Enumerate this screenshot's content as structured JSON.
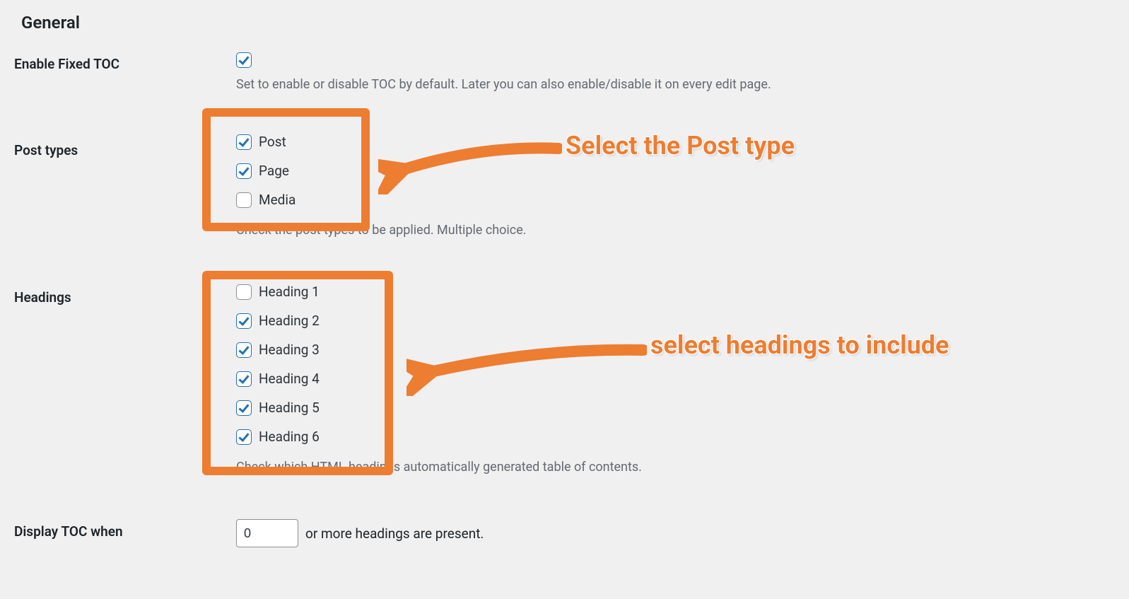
{
  "section_title": "General",
  "rows": {
    "enable_toc": {
      "label": "Enable Fixed TOC",
      "checked": true,
      "description": "Set to enable or disable TOC by default. Later you can also enable/disable it on every edit page."
    },
    "post_types": {
      "label": "Post types",
      "options": [
        {
          "label": "Post",
          "checked": true
        },
        {
          "label": "Page",
          "checked": true
        },
        {
          "label": "Media",
          "checked": false
        }
      ],
      "description": "Check the post types to be applied. Multiple choice."
    },
    "headings": {
      "label": "Headings",
      "options": [
        {
          "label": "Heading 1",
          "checked": false
        },
        {
          "label": "Heading 2",
          "checked": true
        },
        {
          "label": "Heading 3",
          "checked": true
        },
        {
          "label": "Heading 4",
          "checked": true
        },
        {
          "label": "Heading 5",
          "checked": true
        },
        {
          "label": "Heading 6",
          "checked": true
        }
      ],
      "description": "Check which HTML headings automatically generated table of contents."
    },
    "display_when": {
      "label": "Display TOC when",
      "value": "0",
      "suffix": "or more headings are present."
    }
  },
  "annotations": {
    "post_types": "Select the Post type",
    "headings": "select headings to include"
  },
  "colors": {
    "highlight": "#ed7d31",
    "checkbox_checked": "#2271b1"
  }
}
